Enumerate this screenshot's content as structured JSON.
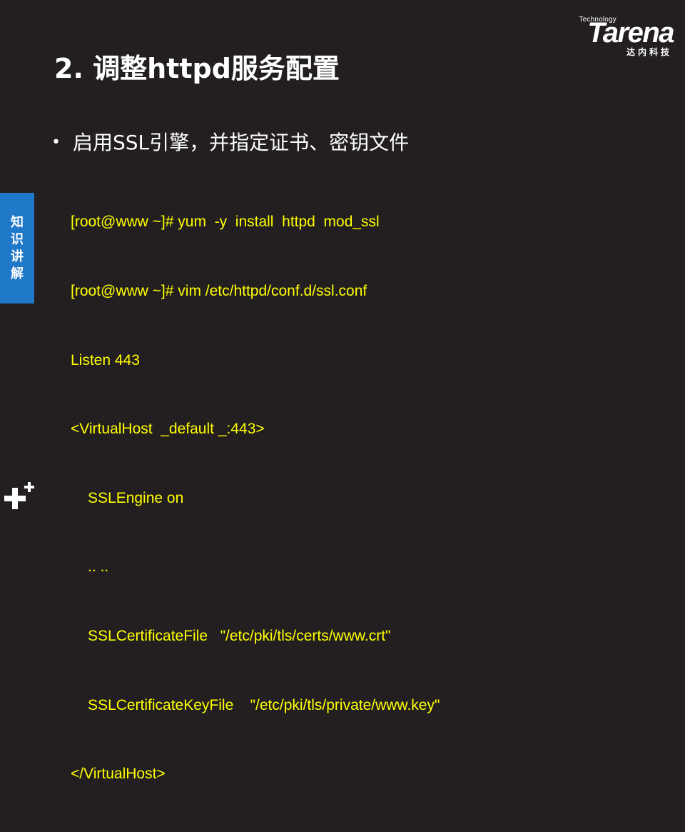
{
  "logo": {
    "technology": "Technology",
    "wordmark": "Tarena",
    "chinese": "达内科技"
  },
  "slide": {
    "title": "2. 调整httpd服务配置",
    "bullet": "启用SSL引擎，并指定证书、密钥文件",
    "side_tab": [
      "知",
      "识",
      "讲",
      "解"
    ]
  },
  "code": {
    "lines": [
      "[root@www ~]# yum  -y  install  httpd  mod_ssl",
      "[root@www ~]# vim /etc/httpd/conf.d/ssl.conf",
      "Listen 443",
      "<VirtualHost  _default _:443>",
      "SSLEngine on",
      ".. ..",
      "SSLCertificateFile   \"/etc/pki/tls/certs/www.crt\"",
      "SSLCertificateKeyFile    \"/etc/pki/tls/private/www.key\"",
      "</VirtualHost>"
    ]
  },
  "colors": {
    "background": "#231f20",
    "code_text": "#ffff00",
    "side_tab": "#1f78c8",
    "text": "#ffffff"
  }
}
